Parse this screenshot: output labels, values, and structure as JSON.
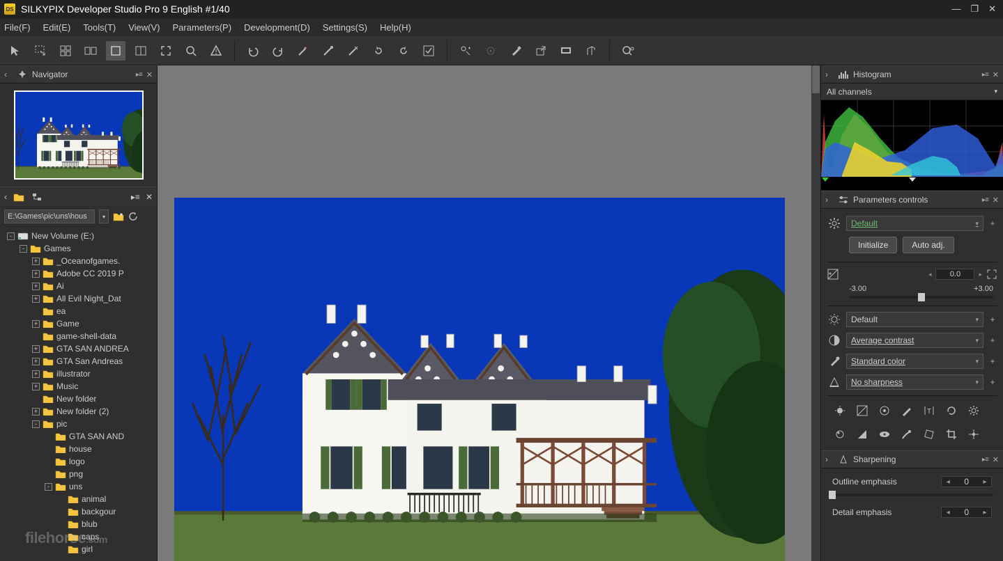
{
  "app": {
    "title": "SILKYPIX Developer Studio Pro 9 English  #1/40",
    "logo_text": "DS"
  },
  "menu": {
    "file": "File(F)",
    "edit": "Edit(E)",
    "tools": "Tools(T)",
    "view": "View(V)",
    "parameters": "Parameters(P)",
    "development": "Development(D)",
    "settings": "Settings(S)",
    "help": "Help(H)"
  },
  "panels": {
    "navigator": "Navigator",
    "histogram": "Histogram",
    "histogram_mode": "All channels",
    "parameters_controls": "Parameters controls",
    "sharpening": "Sharpening"
  },
  "folder": {
    "path": "E:\\Games\\pic\\uns\\hous",
    "tree": [
      {
        "depth": 0,
        "exp": "-",
        "icon": "drive",
        "label": "New Volume (E:)"
      },
      {
        "depth": 1,
        "exp": "-",
        "icon": "folder",
        "label": "Games"
      },
      {
        "depth": 2,
        "exp": "+",
        "icon": "folder",
        "label": "_Oceanofgames."
      },
      {
        "depth": 2,
        "exp": "+",
        "icon": "folder",
        "label": "Adobe CC 2019 P"
      },
      {
        "depth": 2,
        "exp": "+",
        "icon": "folder",
        "label": "Ai"
      },
      {
        "depth": 2,
        "exp": "+",
        "icon": "folder",
        "label": "All Evil Night_Dat"
      },
      {
        "depth": 2,
        "exp": "",
        "icon": "folder",
        "label": "ea"
      },
      {
        "depth": 2,
        "exp": "+",
        "icon": "folder",
        "label": "Game"
      },
      {
        "depth": 2,
        "exp": "",
        "icon": "folder",
        "label": "game-shell-data"
      },
      {
        "depth": 2,
        "exp": "+",
        "icon": "folder",
        "label": "GTA SAN ANDREA"
      },
      {
        "depth": 2,
        "exp": "+",
        "icon": "folder",
        "label": "GTA San Andreas"
      },
      {
        "depth": 2,
        "exp": "+",
        "icon": "folder",
        "label": "illustrator"
      },
      {
        "depth": 2,
        "exp": "+",
        "icon": "folder",
        "label": "Music"
      },
      {
        "depth": 2,
        "exp": "",
        "icon": "folder",
        "label": "New folder"
      },
      {
        "depth": 2,
        "exp": "+",
        "icon": "folder",
        "label": "New folder (2)"
      },
      {
        "depth": 2,
        "exp": "-",
        "icon": "folder",
        "label": "pic"
      },
      {
        "depth": 3,
        "exp": "",
        "icon": "folder",
        "label": "GTA SAN AND"
      },
      {
        "depth": 3,
        "exp": "",
        "icon": "folder",
        "label": "house"
      },
      {
        "depth": 3,
        "exp": "",
        "icon": "folder",
        "label": "logo"
      },
      {
        "depth": 3,
        "exp": "",
        "icon": "folder",
        "label": "png"
      },
      {
        "depth": 3,
        "exp": "-",
        "icon": "folder",
        "label": "uns"
      },
      {
        "depth": 4,
        "exp": "",
        "icon": "folder",
        "label": "animal"
      },
      {
        "depth": 4,
        "exp": "",
        "icon": "folder",
        "label": "backgour"
      },
      {
        "depth": 4,
        "exp": "",
        "icon": "folder",
        "label": "blub"
      },
      {
        "depth": 4,
        "exp": "",
        "icon": "folder",
        "label": "caps"
      },
      {
        "depth": 4,
        "exp": "",
        "icon": "folder",
        "label": "girl"
      }
    ]
  },
  "params": {
    "preset": "Default",
    "initialize": "Initialize",
    "autoadj": "Auto adj.",
    "exposure_value": "0.0",
    "exp_min": "-3.00",
    "exp_max": "+3.00",
    "brightness": "Default",
    "contrast": "Average contrast",
    "color": "Standard color",
    "sharpness": "No sharpness"
  },
  "sharpening": {
    "outline_label": "Outline emphasis",
    "outline_value": "0",
    "detail_label": "Detail emphasis",
    "detail_value": "0"
  },
  "watermark": {
    "text": "filehorse",
    "suffix": ".com"
  }
}
